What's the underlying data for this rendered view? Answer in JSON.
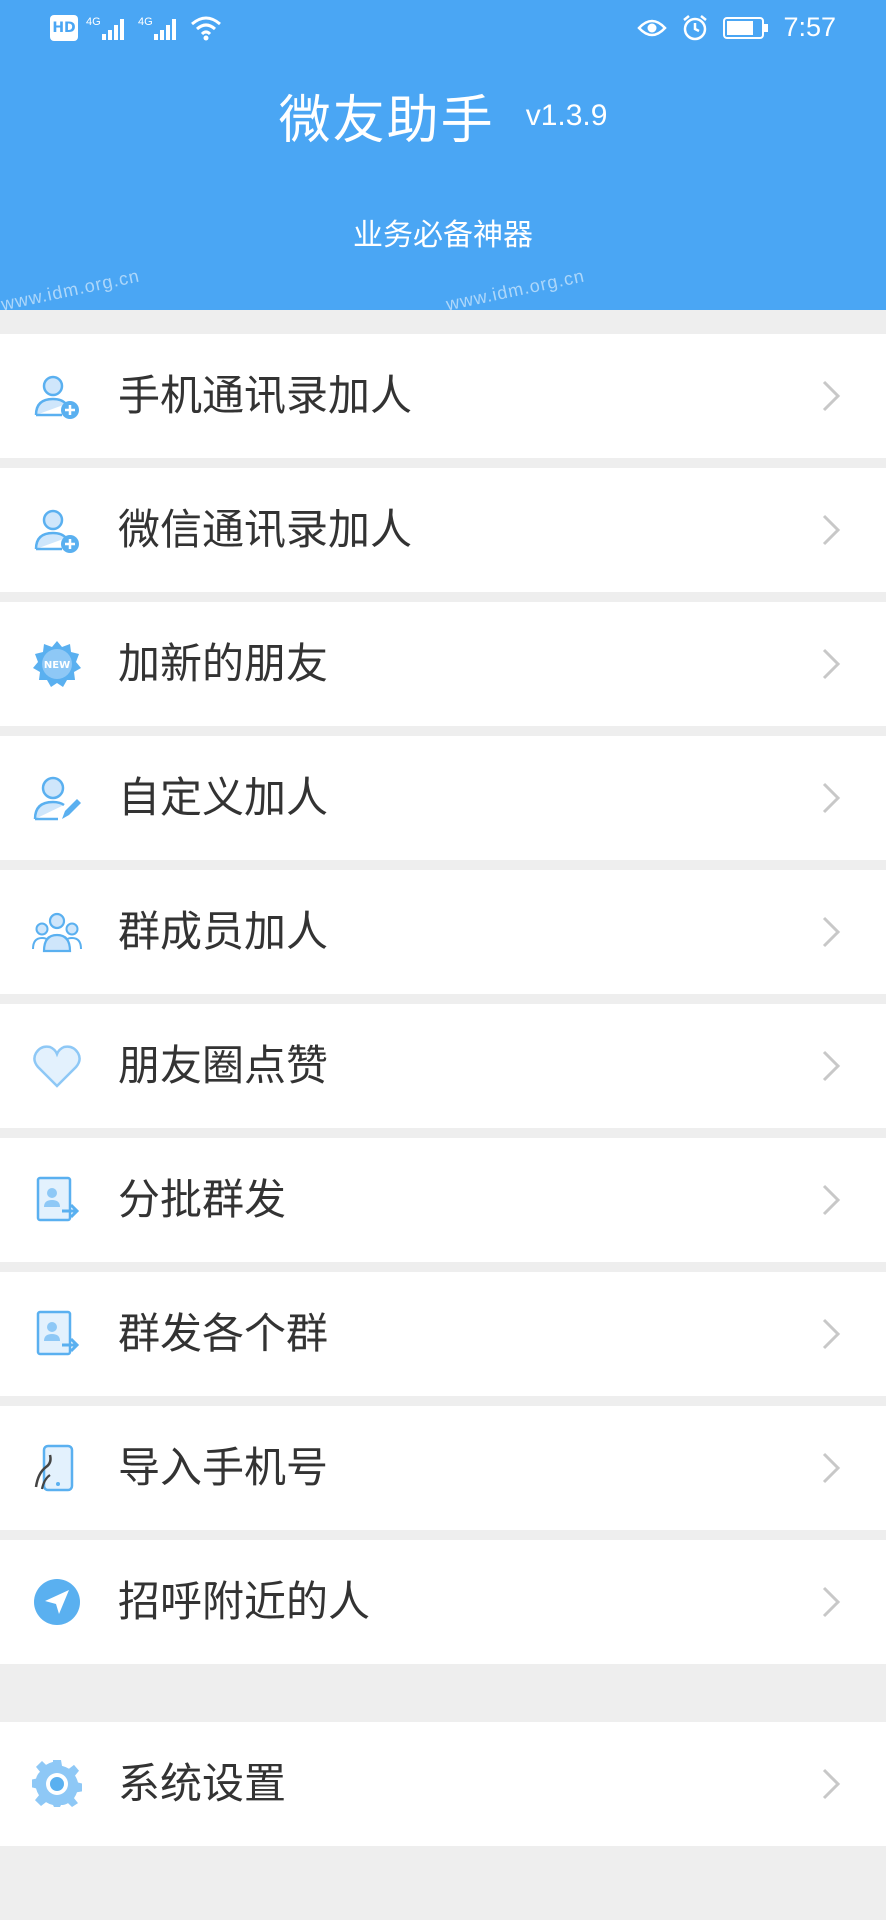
{
  "status_bar": {
    "hd_label": "HD",
    "signal1_label": "4G",
    "signal2_label": "4G",
    "time": "7:57"
  },
  "header": {
    "title": "微友助手",
    "version": "v1.3.9",
    "subtitle": "业务必备神器",
    "watermark": "www.idm.org.cn"
  },
  "menu": {
    "items": [
      {
        "label": "手机通讯录加人",
        "icon": "add-contact-icon"
      },
      {
        "label": "微信通讯录加人",
        "icon": "add-contact-icon"
      },
      {
        "label": "加新的朋友",
        "icon": "new-badge-icon"
      },
      {
        "label": "自定义加人",
        "icon": "user-edit-icon"
      },
      {
        "label": "群成员加人",
        "icon": "group-icon"
      },
      {
        "label": "朋友圈点赞",
        "icon": "heart-icon"
      },
      {
        "label": "分批群发",
        "icon": "contact-send-icon"
      },
      {
        "label": "群发各个群",
        "icon": "contact-send-icon"
      },
      {
        "label": "导入手机号",
        "icon": "import-phone-icon"
      },
      {
        "label": "招呼附近的人",
        "icon": "location-arrow-icon"
      }
    ],
    "settings": {
      "label": "系统设置",
      "icon": "gear-icon"
    }
  },
  "colors": {
    "header_bg": "#4aa6f4",
    "icon_blue": "#5ab0f0",
    "icon_light": "#cfe6fb",
    "page_bg": "#eeeeee",
    "text": "#333333",
    "chevron": "#c8c8c8"
  }
}
